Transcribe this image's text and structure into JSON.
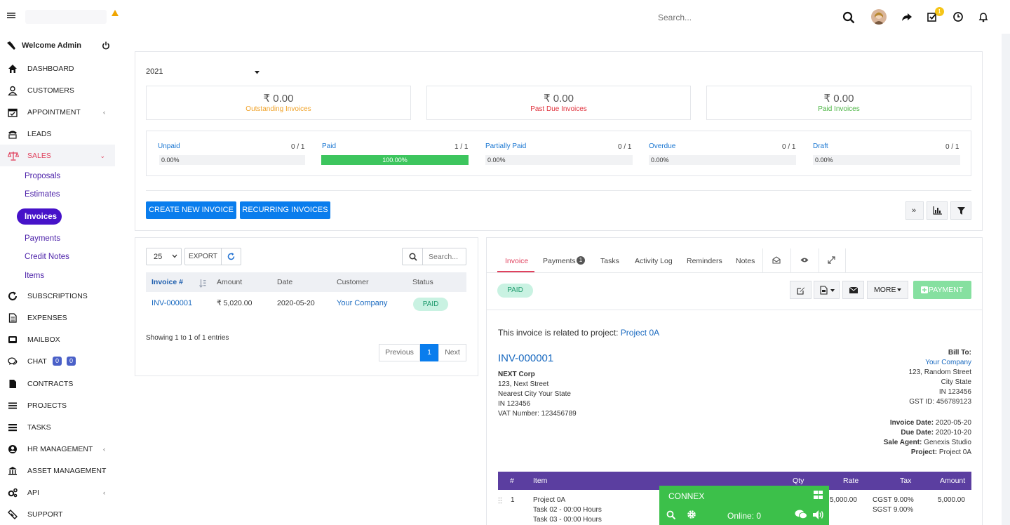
{
  "topbar": {
    "search_placeholder": "Search..."
  },
  "notifications": {
    "tasks_badge": "1"
  },
  "sidebar": {
    "welcome": "Welcome Admin",
    "items": [
      {
        "label": "DASHBOARD"
      },
      {
        "label": "CUSTOMERS"
      },
      {
        "label": "APPOINTMENT"
      },
      {
        "label": "LEADS"
      },
      {
        "label": "SALES"
      },
      {
        "label": "SUBSCRIPTIONS"
      },
      {
        "label": "EXPENSES"
      },
      {
        "label": "MAILBOX"
      },
      {
        "label": "CHAT"
      },
      {
        "label": "CONTRACTS"
      },
      {
        "label": "PROJECTS"
      },
      {
        "label": "TASKS"
      },
      {
        "label": "HR MANAGEMENT"
      },
      {
        "label": "ASSET MANAGEMENT"
      },
      {
        "label": "API"
      },
      {
        "label": "SUPPORT"
      }
    ],
    "sales_sub": [
      "Proposals",
      "Estimates",
      "Invoices",
      "Payments",
      "Credit Notes",
      "Items"
    ],
    "chat_badges": [
      "0",
      "0"
    ]
  },
  "year_select": "2021",
  "stats": [
    {
      "value": "₹ 0.00",
      "label": "Outstanding Invoices",
      "color": "#f0a32a"
    },
    {
      "value": "₹ 0.00",
      "label": "Past Due Invoices",
      "color": "#e0313c"
    },
    {
      "value": "₹ 0.00",
      "label": "Paid Invoices",
      "color": "#4bb543"
    }
  ],
  "progress": [
    {
      "name": "Unpaid",
      "count": "0 / 1",
      "percent": "0.00%",
      "fill": 0
    },
    {
      "name": "Paid",
      "count": "1 / 1",
      "percent": "100.00%",
      "fill": 1
    },
    {
      "name": "Partially Paid",
      "count": "0 / 1",
      "percent": "0.00%",
      "fill": 0
    },
    {
      "name": "Overdue",
      "count": "0 / 1",
      "percent": "0.00%",
      "fill": 0
    },
    {
      "name": "Draft",
      "count": "0 / 1",
      "percent": "0.00%",
      "fill": 0
    }
  ],
  "actions": {
    "create": "CREATE NEW INVOICE",
    "recurring": "RECURRING INVOICES"
  },
  "table": {
    "page_size": "25",
    "export": "EXPORT",
    "search_placeholder": "Search...",
    "headers": [
      "Invoice #",
      "Amount",
      "Date",
      "Customer",
      "Status"
    ],
    "rows": [
      {
        "invoice": "INV-000001",
        "amount": "₹ 5,020.00",
        "date": "2020-05-20",
        "customer": "Your Company",
        "status": "PAID"
      }
    ],
    "info": "Showing 1 to 1 of 1 entries",
    "pagination": {
      "prev": "Previous",
      "page": "1",
      "next": "Next"
    }
  },
  "detail": {
    "tabs": [
      "Invoice",
      "Payments",
      "Tasks",
      "Activity Log",
      "Reminders",
      "Notes"
    ],
    "payments_badge": "1",
    "status": "PAID",
    "more": "MORE",
    "payment_btn": "PAYMENT",
    "related_text": "This invoice is related to project:",
    "related_project": "Project 0A",
    "invoice_number": "INV-000001",
    "from": {
      "company": "NEXT Corp",
      "lines": [
        "123, Next Street",
        "Nearest City Your State",
        "IN 123456",
        "VAT Number: 123456789"
      ]
    },
    "bill_to": {
      "label": "Bill To:",
      "company": "Your Company",
      "lines": [
        "123, Random Street",
        "City State",
        "IN 123456",
        "GST ID: 456789123"
      ]
    },
    "meta": [
      {
        "label": "Invoice Date:",
        "value": "2020-05-20"
      },
      {
        "label": "Due Date:",
        "value": "2020-10-20"
      },
      {
        "label": "Sale Agent:",
        "value": "Genexis Studio"
      },
      {
        "label": "Project:",
        "value": "Project 0A"
      }
    ],
    "items_headers": [
      "#",
      "Item",
      "Qty",
      "Rate",
      "Tax",
      "Amount"
    ],
    "item": {
      "num": "1",
      "name": "Project 0A",
      "tasks": [
        "Task 02 - 00:00 Hours",
        "Task 03 - 00:00 Hours"
      ],
      "rate": "5,000.00",
      "taxes": [
        "CGST 9.00%",
        "SGST 9.00%"
      ],
      "amount": "5,000.00"
    },
    "header_color": "#5b3ea0"
  },
  "connex": {
    "title": "CONNEX",
    "online": "Online: 0",
    "color": "#3cc04a"
  }
}
